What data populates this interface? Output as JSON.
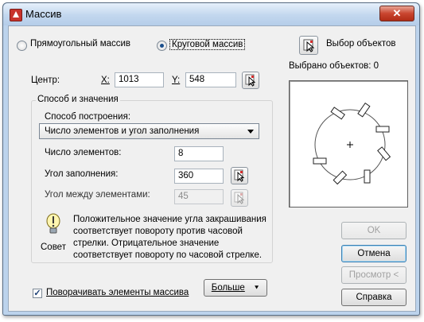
{
  "window": {
    "title": "Массив",
    "close_glyph": "✕"
  },
  "array_type": {
    "rectangular_label": "Прямоугольный массив",
    "polar_label": "Круговой массив",
    "selected": "polar"
  },
  "select_objects": {
    "label": "Выбор объектов",
    "selected_count_text": "Выбрано объектов: 0"
  },
  "center": {
    "label": "Центр:",
    "x_label": "X:",
    "x_value": "1013",
    "y_label": "Y:",
    "y_value": "548"
  },
  "method_group": {
    "title": "Способ и значения",
    "method_label": "Способ построения:",
    "method_value": "Число элементов и угол заполнения",
    "count_label": "Число элементов:",
    "count_value": "8",
    "fill_angle_label": "Угол заполнения:",
    "fill_angle_value": "360",
    "between_angle_label": "Угол между элементами:",
    "between_angle_value": "45"
  },
  "tip": {
    "caption": "Совет",
    "text": "Положительное значение угла закрашивания соответствует повороту против часовой стрелки. Отрицательное значение соответствует повороту по часовой стрелке."
  },
  "rotate_items": {
    "label": "Поворачивать элементы массива",
    "checked": true
  },
  "more_button": {
    "label": "Больше",
    "glyph": "⯆"
  },
  "buttons": {
    "ok": "OK",
    "cancel": "Отмена",
    "preview": "Просмотр <",
    "help": "Справка"
  },
  "preview_image": {
    "center_mark": "+",
    "item_count": 8
  },
  "colors": {
    "titlebar": "#c2d7ee",
    "close": "#c9452f",
    "dialog_bg": "#f0f0f0"
  }
}
